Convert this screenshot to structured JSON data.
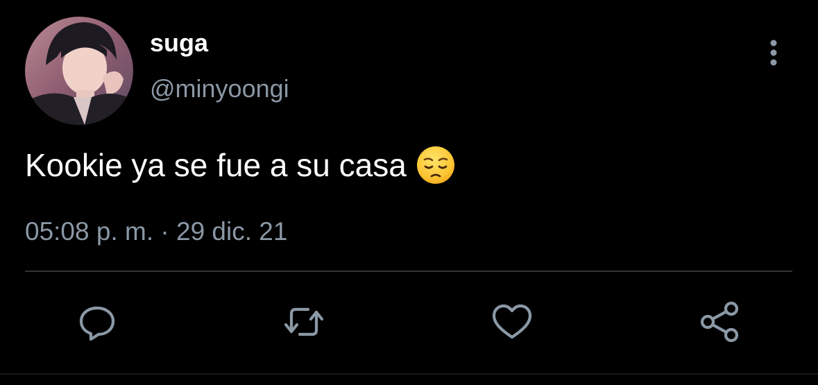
{
  "tweet": {
    "display_name": "suga",
    "handle": "@minyoongi",
    "text": "Kookie ya se fue a su casa",
    "emoji": "pensive-face",
    "timestamp": "05:08 p. m. · 29 dic. 21"
  },
  "icons": {
    "more": "more-vertical-icon",
    "reply": "reply-bubble-icon",
    "retweet": "retweet-icon",
    "like": "heart-icon",
    "share": "share-icon"
  },
  "colors": {
    "background": "#000000",
    "primary_text": "#ffffff",
    "secondary_text": "#8b98a5",
    "divider": "#2f3336"
  }
}
